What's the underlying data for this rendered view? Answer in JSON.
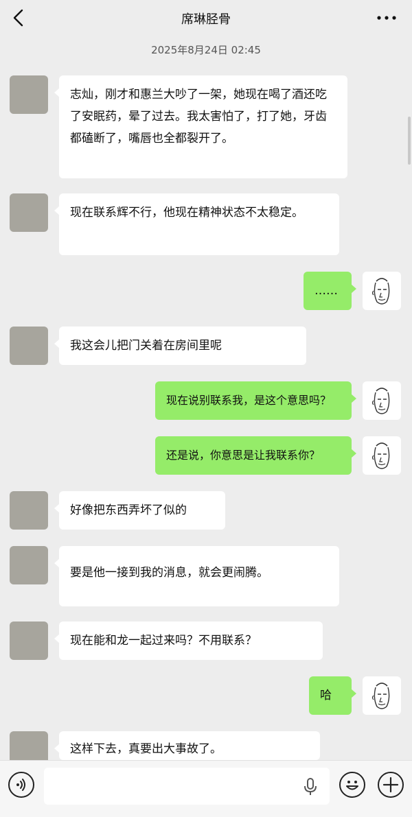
{
  "header": {
    "title": "席琳胫骨",
    "back_icon": "chevron-left-icon",
    "more_icon": "ellipsis-icon"
  },
  "timestamp": "2025年8月24日 02:45",
  "messages": [
    {
      "side": "left",
      "text": "志灿，刚才和惠兰大吵了一架，她现在喝了酒还吃了安眠药，晕了过去。我太害怕了，打了她，牙齿都磕断了，嘴唇也全都裂开了。"
    },
    {
      "side": "left",
      "text": "现在联系辉不行，他现在精神状态不太稳定。"
    },
    {
      "side": "right",
      "text": "……"
    },
    {
      "side": "left",
      "text": "我这会儿把门关着在房间里呢"
    },
    {
      "side": "right",
      "text": "现在说别联系我，是这个意思吗？"
    },
    {
      "side": "right",
      "text": "还是说，你意思是让我联系你？"
    },
    {
      "side": "left",
      "text": "好像把东西弄坏了似的"
    },
    {
      "side": "left",
      "text": "要是他一接到我的消息，就会更闹腾。"
    },
    {
      "side": "left",
      "text": "现在能和龙一起过来吗？不用联系？"
    },
    {
      "side": "right",
      "text": "哈"
    },
    {
      "side": "left",
      "text": "这样下去，真要出大事故了。"
    }
  ],
  "colors": {
    "background": "#ededed",
    "bubble_self": "#95ec69",
    "bubble_other": "#ffffff",
    "avatar_placeholder": "#a7a59d"
  },
  "bottom_bar": {
    "voice_icon": "voice-icon",
    "mic_icon": "microphone-icon",
    "emoji_icon": "emoji-icon",
    "plus_icon": "plus-icon"
  }
}
